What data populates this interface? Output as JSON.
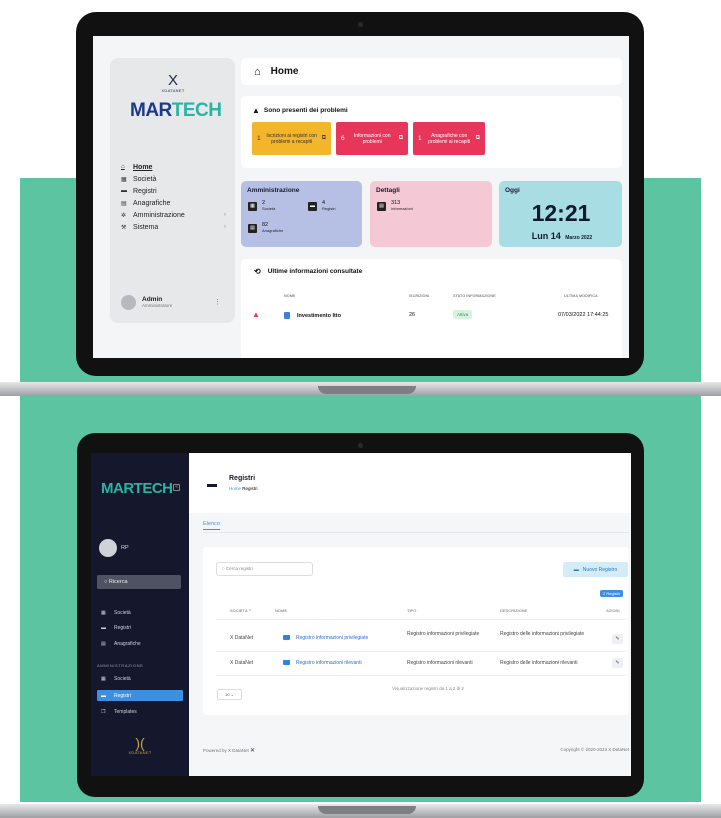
{
  "screen1": {
    "sidebar": {
      "logo_mark": "X",
      "logo_word": "XDATANET",
      "brand_part1": "MAR",
      "brand_part2": "TECH",
      "nav": [
        {
          "label": "Home",
          "icon": "home-icon",
          "glyph": "⌂"
        },
        {
          "label": "Società",
          "icon": "building-icon",
          "glyph": "▦"
        },
        {
          "label": "Registri",
          "icon": "folder-icon",
          "glyph": "▬"
        },
        {
          "label": "Anagrafiche",
          "icon": "id-card-icon",
          "glyph": "▤"
        },
        {
          "label": "Amministrazione",
          "icon": "gear-icon",
          "glyph": "✲"
        },
        {
          "label": "Sistema",
          "icon": "tools-icon",
          "glyph": "⚒"
        }
      ],
      "profile_name": "Admin",
      "profile_role": "Amministratore"
    },
    "header_title": "Home",
    "problems": {
      "title": "Sono presenti dei problemi",
      "chips": [
        {
          "count": "1",
          "text": "Iscrizioni ai registri con problemi a recapiti"
        },
        {
          "count": "6",
          "text": "Informazioni con problemi"
        },
        {
          "count": "1",
          "text": "Anagrafiche con problemi ai recapiti"
        }
      ]
    },
    "admin": {
      "title": "Amministrazione",
      "companies_value": "2",
      "companies_label": "Società",
      "registers_value": "4",
      "registers_label": "Registri",
      "profiles_value": "82",
      "profiles_label": "Anagrafiche"
    },
    "details": {
      "title": "Dettagli",
      "value": "313",
      "label": "Informazioni"
    },
    "today": {
      "title": "Oggi",
      "time": "12:21",
      "day": "Lun 14",
      "month_year": "Marzo 2022"
    },
    "recent": {
      "title": "Ultime informazioni consultate",
      "headers": [
        "NOME",
        "ISCRIZIONI",
        "STATO INFORMAZIONE",
        "ULTIMA MODIFICA"
      ],
      "row": {
        "name": "Investimento Itto",
        "subs": "26",
        "status": "Attiva",
        "modified": "07/03/2022 17:44:25"
      }
    }
  },
  "screen2": {
    "sidebar": {
      "brand_part1": "MAR",
      "brand_part2": "TECH",
      "user": "RP",
      "search": "Ricerca",
      "nav": [
        {
          "label": "Società",
          "glyph": "▦"
        },
        {
          "label": "Registri",
          "glyph": "▬"
        },
        {
          "label": "Anagrafiche",
          "glyph": "▤"
        }
      ],
      "section": "AMMINISTRAZIONE",
      "admin_nav": [
        {
          "label": "Società",
          "glyph": "▦"
        },
        {
          "label": "Registri",
          "glyph": "▬"
        },
        {
          "label": "Templates",
          "glyph": "❐"
        }
      ],
      "logo_word": "XDATANET"
    },
    "page_title": "Registri",
    "crumb_home": "Home",
    "crumb_current": "Registri",
    "tab": "Elenco",
    "search_placeholder": "Cerca registri",
    "new_button": "Nuovo Registro",
    "count_badge": "2 Registri",
    "headers": [
      "SOCIETÀ",
      "NOME",
      "TIPO",
      "DESCRIZIONE",
      "AZIONI"
    ],
    "rows": [
      {
        "company": "X DataNet",
        "name": "Registro informazioni privilegiate",
        "type": "Registro informazioni privilegiate",
        "desc": "Registro delle informazioni privilegiate"
      },
      {
        "company": "X DataNet",
        "name": "Registro informazioni rilevanti",
        "type": "Registro informazioni rilevanti",
        "desc": "Registro delle informazioni rilevanti"
      }
    ],
    "page_size": "10",
    "pagination_info": "Visualizzazione registri da 1 a 2 di 2",
    "footer_left": "Powered by  X DataNet",
    "footer_right": "Copyright © 2020-2023 X DataNet"
  },
  "colors": {
    "background_green": "#5cc4a0",
    "brand_blue": "#1b3a8a",
    "brand_teal": "#2bb3a3",
    "alert_red": "#e8365b",
    "alert_yellow": "#f3b529"
  }
}
